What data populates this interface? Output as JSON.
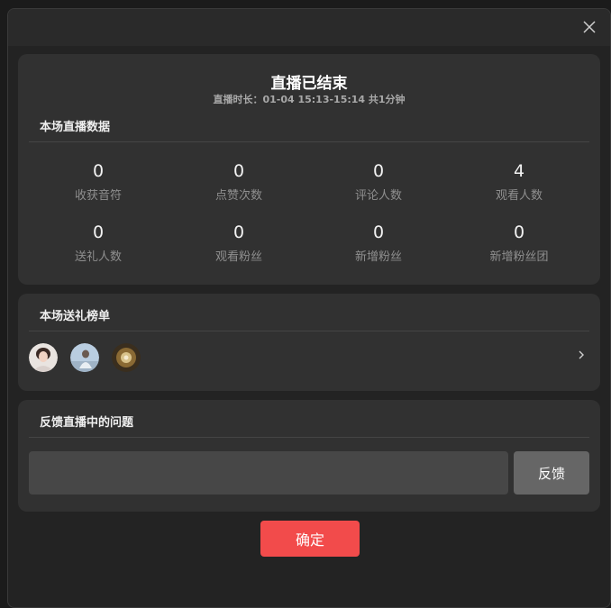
{
  "header": {
    "title": "直播已结束",
    "subtitle": "直播时长：01-04 15:13-15:14 共1分钟"
  },
  "stats_section": {
    "title": "本场直播数据",
    "items": [
      {
        "value": "0",
        "label": "收获音符"
      },
      {
        "value": "0",
        "label": "点赞次数"
      },
      {
        "value": "0",
        "label": "评论人数"
      },
      {
        "value": "4",
        "label": "观看人数"
      },
      {
        "value": "0",
        "label": "送礼人数"
      },
      {
        "value": "0",
        "label": "观看粉丝"
      },
      {
        "value": "0",
        "label": "新增粉丝"
      },
      {
        "value": "0",
        "label": "新增粉丝团"
      }
    ]
  },
  "gift_section": {
    "title": "本场送礼榜单",
    "avatars": [
      "avatar-1",
      "avatar-2",
      "avatar-3"
    ]
  },
  "feedback_section": {
    "title": "反馈直播中的问题",
    "input_value": "",
    "button_label": "反馈"
  },
  "confirm_label": "确定",
  "colors": {
    "accent": "#f24b4b",
    "card": "#313131",
    "background": "#232323"
  }
}
